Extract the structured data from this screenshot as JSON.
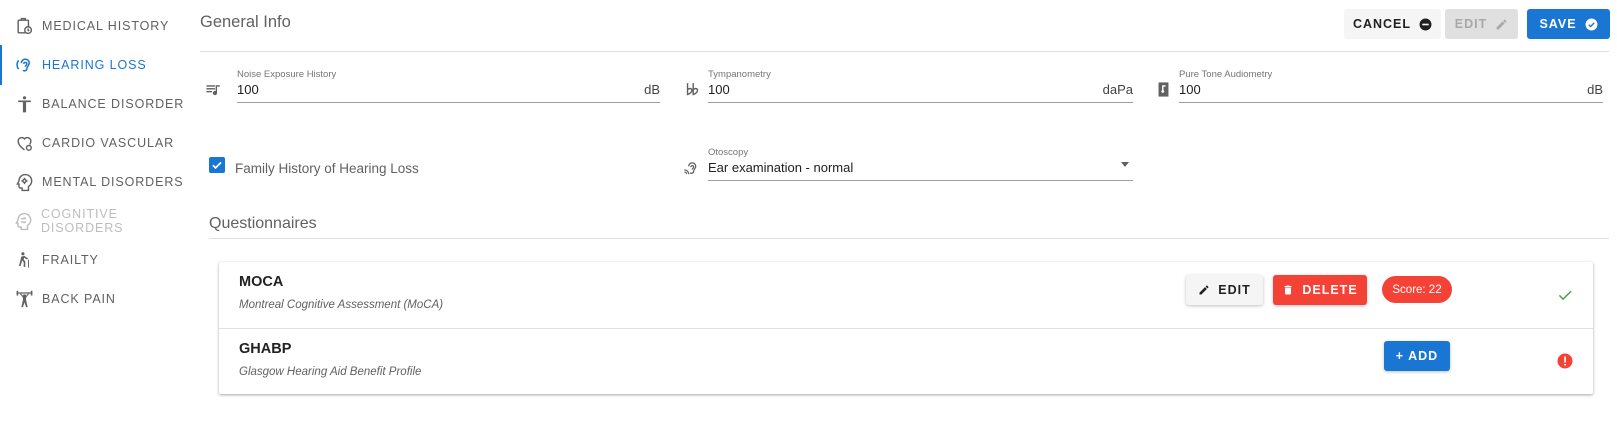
{
  "sidebar": {
    "items": [
      {
        "label": "MEDICAL HISTORY",
        "icon": "clipboard-clock-icon"
      },
      {
        "label": "HEARING LOSS",
        "icon": "ear-icon",
        "active": true
      },
      {
        "label": "BALANCE DISORDER",
        "icon": "person-standing-icon"
      },
      {
        "label": "CARDIO VASCULAR",
        "icon": "heart-pulse-icon"
      },
      {
        "label": "MENTAL DISORDERS",
        "icon": "head-gear-icon"
      },
      {
        "label": "COGNITIVE DISORDERS",
        "icon": "brain-icon",
        "disabled": true
      },
      {
        "label": "FRAILTY",
        "icon": "person-cane-icon"
      },
      {
        "label": "BACK PAIN",
        "icon": "weightlifter-icon"
      }
    ]
  },
  "header": {
    "title": "General Info",
    "cancel_label": "CANCEL",
    "edit_label": "EDIT",
    "save_label": "SAVE"
  },
  "fields": {
    "noise": {
      "label": "Noise Exposure History",
      "value": "100",
      "unit": "dB",
      "icon": "music-list-icon"
    },
    "tympanometry": {
      "label": "Tympanometry",
      "value": "100",
      "unit": "daPa",
      "icon": "double-flat-icon"
    },
    "pure_tone": {
      "label": "Pure Tone Audiometry",
      "value": "100",
      "unit": "dB",
      "icon": "audio-book-icon"
    },
    "family_history": {
      "label": "Family History of Hearing Loss",
      "checked": true
    },
    "otoscopy": {
      "label": "Otoscopy",
      "value": "Ear examination - normal",
      "icon": "hearing-icon"
    }
  },
  "questionnaires": {
    "title": "Questionnaires",
    "items": [
      {
        "name": "MOCA",
        "description": "Montreal Cognitive Assessment (MoCA)",
        "edit_label": "EDIT",
        "delete_label": "DELETE",
        "score": "Score: 22",
        "status": "complete",
        "status_icon": "check-icon"
      },
      {
        "name": "GHABP",
        "description": "Glasgow Hearing Aid Benefit Profile",
        "add_label": "+ ADD",
        "status": "missing",
        "status_icon": "error-icon"
      }
    ]
  },
  "colors": {
    "primary": "#1976d2",
    "danger": "#f44336",
    "success": "#43a047"
  }
}
